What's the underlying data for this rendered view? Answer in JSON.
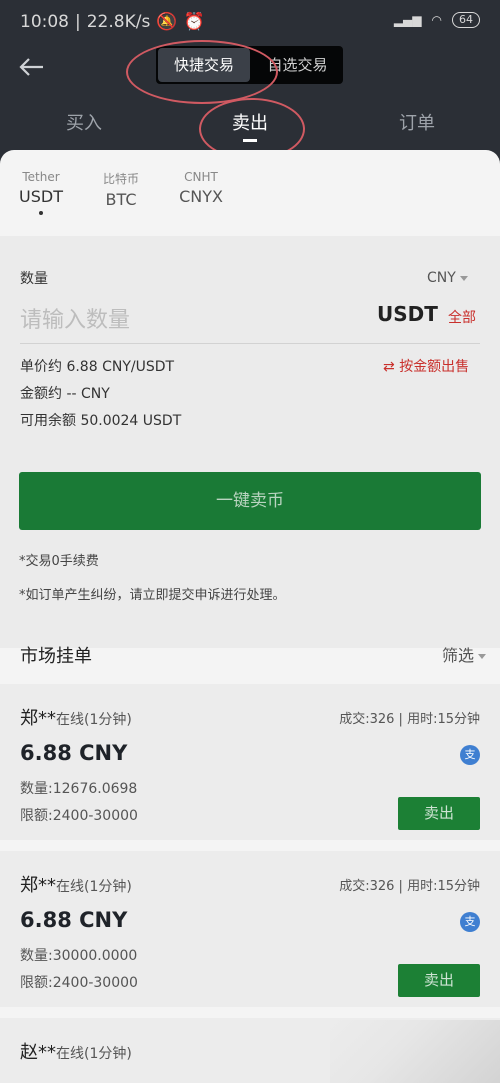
{
  "status": {
    "time": "10:08",
    "speed": "22.8K/s",
    "battery": "64"
  },
  "header": {
    "back_icon": "arrow-left-icon",
    "seg_active": "快捷交易",
    "seg_other": "自选交易"
  },
  "tabs": [
    "买入",
    "卖出",
    "订单"
  ],
  "coins": [
    {
      "sub": "Tether",
      "name": "USDT"
    },
    {
      "sub": "比特币",
      "name": "BTC"
    },
    {
      "sub": "CNHT",
      "name": "CNYX"
    }
  ],
  "form": {
    "qty_label": "数量",
    "currency": "CNY",
    "qty_placeholder": "请输入数量",
    "unit": "USDT",
    "all": "全部",
    "unit_price": "单价约 6.88 CNY/USDT",
    "amount": "金额约 -- CNY",
    "balance": "可用余额 50.0024 USDT",
    "swap": "按金额出售",
    "sell_button": "一键卖币",
    "note1": "*交易0手续费",
    "note2": "*如订单产生纠纷，请立即提交申诉进行处理。"
  },
  "market": {
    "title": "市场挂单",
    "filter": "筛选"
  },
  "cards": [
    {
      "name": "郑**",
      "online": "在线(1分钟)",
      "stat": "成交:326 | 用时:15分钟",
      "price": "6.88 CNY",
      "pay": "支",
      "qty": "数量:12676.0698",
      "limit": "限额:2400-30000",
      "btn": "卖出"
    },
    {
      "name": "郑**",
      "online": "在线(1分钟)",
      "stat": "成交:326 | 用时:15分钟",
      "price": "6.88 CNY",
      "pay": "支",
      "qty": "数量:30000.0000",
      "limit": "限额:2400-30000",
      "btn": "卖出"
    },
    {
      "name": "赵**",
      "online": "在线(1分钟)"
    }
  ]
}
